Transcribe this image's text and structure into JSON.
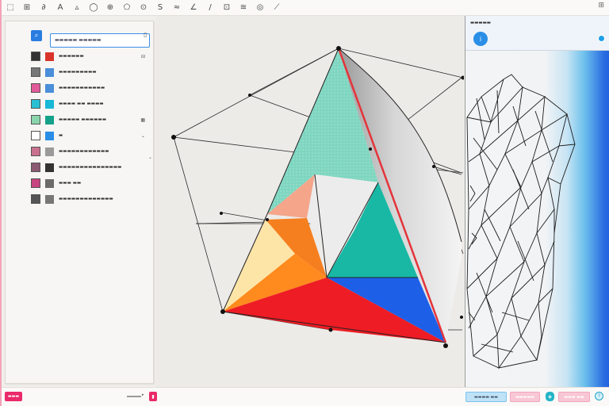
{
  "toolbar": {
    "tools": [
      {
        "icon": "select-tool-icon",
        "glyph": "⬚"
      },
      {
        "icon": "grid-tool-icon",
        "glyph": "⊞"
      },
      {
        "icon": "link-tool-icon",
        "glyph": "∂"
      },
      {
        "icon": "text-tool-icon",
        "glyph": "A"
      },
      {
        "icon": "triangle-tool-icon",
        "glyph": "▵"
      },
      {
        "icon": "circle-tool-icon",
        "glyph": "◯"
      },
      {
        "icon": "shape-tool-icon",
        "glyph": "⊕"
      },
      {
        "icon": "polygon-tool-icon",
        "glyph": "⬠"
      },
      {
        "icon": "vertex-tool-icon",
        "glyph": "⊙"
      },
      {
        "icon": "curve-tool-icon",
        "glyph": "S"
      },
      {
        "icon": "freehand-tool-icon",
        "glyph": "≈"
      },
      {
        "icon": "angle-tool-icon",
        "glyph": "∠"
      },
      {
        "icon": "line-tool-icon",
        "glyph": "/"
      },
      {
        "icon": "measure-tool-icon",
        "glyph": "⊡"
      },
      {
        "icon": "ruler-tool-icon",
        "glyph": "≋"
      },
      {
        "icon": "node-tool-icon",
        "glyph": "◎"
      },
      {
        "icon": "pen-tool-icon",
        "glyph": "⟋"
      }
    ],
    "right_label": "⊞"
  },
  "left_panel": {
    "search_button": "⌕",
    "search_placeholder": "▬▬▬▬▬ ▬▬▬▬▬",
    "layers": [
      {
        "swatch": "#2a2a2a",
        "swatch2": "#d9342b",
        "label": "▬▬▬▬▬▬",
        "extra": "⊟",
        "thumb": "#333"
      },
      {
        "swatch": "#6b6b6b",
        "swatch2": "#4b8ed9",
        "label": "▬▬▬▬▬▬▬▬▬",
        "extra": "",
        "thumb": "#777"
      },
      {
        "swatch": "#e14a8a",
        "swatch2": "#4b8ed9",
        "label": "▬▬▬▬▬▬▬▬▬▬▬",
        "extra": "",
        "thumb": "#e35a9a"
      },
      {
        "swatch": "#2bc3d6",
        "swatch2": "#18b8d6",
        "label": "▬▬▬▬ ▬▬ ▬▬▬▬",
        "extra": "",
        "thumb": "#29c0d3"
      },
      {
        "swatch": "#8fd8b0",
        "swatch2": "#16a28a",
        "label": "▬▬▬▬▬ ▬▬▬▬▬▬",
        "extra": "▦",
        "thumb": "#8bd5ad"
      },
      {
        "swatch": "#ffffff",
        "swatch2": "#2a8ee6",
        "label": "▬",
        "extra": "⌄",
        "thumb": "#fff"
      },
      {
        "swatch": "#c96b8a",
        "swatch2": "#9a9a9a",
        "label": "▬▬▬▬▬▬▬▬▬▬▬▬",
        "extra": "",
        "thumb": "#c9708e"
      },
      {
        "swatch": "#8a4c6a",
        "swatch2": "#333333",
        "label": "▬▬▬▬▬▬▬▬▬▬▬▬▬▬▬",
        "extra": "",
        "thumb": "#8c5a72"
      },
      {
        "swatch": "#c63c7a",
        "swatch2": "#6b6b6b",
        "label": "▬▬▬ ▬▬",
        "extra": "",
        "thumb": "#c84580"
      },
      {
        "swatch": "#555555",
        "swatch2": "#777777",
        "label": "▬▬▬▬▬▬▬▬▬▬▬▬▬",
        "extra": "",
        "thumb": "#555"
      }
    ],
    "apply_label": "▬▬",
    "info_label": "i"
  },
  "right_panel": {
    "title": "▬▬▬▬▬",
    "badge": "i"
  },
  "statusbar": {
    "left_label": "▬▬▬",
    "mid_label": "▮",
    "zoom_label": "▬▬▬▬ ▬▬",
    "export_label": "▬▬▬▬▬",
    "icon_label": "◈",
    "share_label": "▬▬▬ ▬▬",
    "help_label": "?"
  },
  "colors": {
    "accent_blue": "#2a7de0",
    "accent_pink": "#ea2a6a",
    "canvas_bg": "#edebe8",
    "red_edge": "#e4343a"
  }
}
